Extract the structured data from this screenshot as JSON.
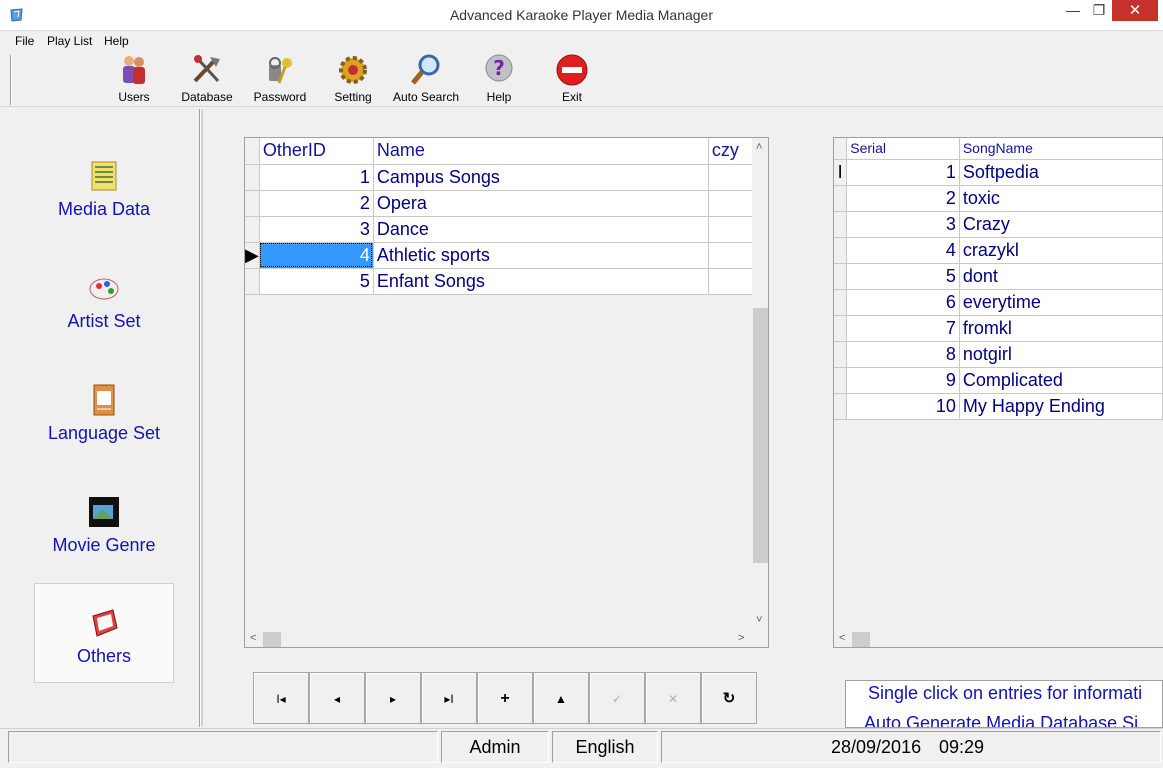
{
  "window": {
    "title": "Advanced Karaoke Player Media Manager",
    "min": "—",
    "max": "❐",
    "close": "✕"
  },
  "menu": [
    "File",
    "Play List",
    "Help"
  ],
  "toolbar": [
    {
      "label": "Users",
      "icon": "users-icon"
    },
    {
      "label": "Database",
      "icon": "database-icon"
    },
    {
      "label": "Password",
      "icon": "password-icon"
    },
    {
      "label": "Setting",
      "icon": "setting-icon"
    },
    {
      "label": "Auto Search",
      "icon": "auto-search-icon"
    },
    {
      "label": "Help",
      "icon": "help-icon"
    },
    {
      "label": "Exit",
      "icon": "exit-icon"
    }
  ],
  "sidebar": [
    {
      "label": "Media Data",
      "icon": "media-data-icon"
    },
    {
      "label": "Artist Set",
      "icon": "artist-set-icon"
    },
    {
      "label": "Language Set",
      "icon": "language-set-icon"
    },
    {
      "label": "Movie Genre",
      "icon": "movie-genre-icon"
    },
    {
      "label": "Others",
      "icon": "others-icon",
      "selected": true
    }
  ],
  "left_grid": {
    "columns": [
      "OtherID",
      "Name",
      "czy"
    ],
    "rows": [
      {
        "id": "1",
        "name": "Campus Songs"
      },
      {
        "id": "2",
        "name": "Opera"
      },
      {
        "id": "3",
        "name": "Dance"
      },
      {
        "id": "4",
        "name": "Athletic sports"
      },
      {
        "id": "5",
        "name": "Enfant Songs"
      }
    ],
    "current_row": 4
  },
  "right_grid": {
    "columns": [
      "Serial",
      "SongName"
    ],
    "rows": [
      {
        "id": "1",
        "name": "Softpedia"
      },
      {
        "id": "2",
        "name": "toxic"
      },
      {
        "id": "3",
        "name": "Crazy"
      },
      {
        "id": "4",
        "name": "crazykl"
      },
      {
        "id": "5",
        "name": "dont"
      },
      {
        "id": "6",
        "name": "everytime"
      },
      {
        "id": "7",
        "name": "fromkl"
      },
      {
        "id": "8",
        "name": "notgirl"
      },
      {
        "id": "9",
        "name": "Complicated"
      },
      {
        "id": "10",
        "name": "My Happy Ending"
      }
    ],
    "current_row_marker": "I"
  },
  "navigator": [
    {
      "name": "first-record-button",
      "glyph": "I◂",
      "enabled": true
    },
    {
      "name": "prior-record-button",
      "glyph": "◂",
      "enabled": true
    },
    {
      "name": "next-record-button",
      "glyph": "▸",
      "enabled": true
    },
    {
      "name": "last-record-button",
      "glyph": "▸I",
      "enabled": true
    },
    {
      "name": "insert-record-button",
      "glyph": "+",
      "enabled": true
    },
    {
      "name": "delete-record-button",
      "glyph": "▲",
      "enabled": true
    },
    {
      "name": "post-record-button",
      "glyph": "✓",
      "enabled": false
    },
    {
      "name": "cancel-record-button",
      "glyph": "✕",
      "enabled": false
    },
    {
      "name": "refresh-record-button",
      "glyph": "↻",
      "enabled": true
    }
  ],
  "info": {
    "line1": "Single click on entries for informati",
    "line2": "Auto Generate Media Database Si"
  },
  "status": {
    "user": "Admin",
    "language": "English",
    "date": "28/09/2016",
    "time": "09:29"
  }
}
